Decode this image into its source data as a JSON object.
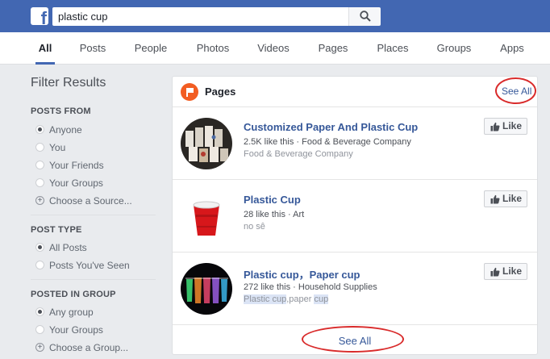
{
  "search": {
    "query": "plastic cup"
  },
  "tabs": [
    {
      "label": "All",
      "active": true
    },
    {
      "label": "Posts"
    },
    {
      "label": "People"
    },
    {
      "label": "Photos"
    },
    {
      "label": "Videos"
    },
    {
      "label": "Pages"
    },
    {
      "label": "Places"
    },
    {
      "label": "Groups"
    },
    {
      "label": "Apps"
    }
  ],
  "filters": {
    "title": "Filter Results",
    "posts_from": {
      "heading": "POSTS FROM",
      "options": [
        "Anyone",
        "You",
        "Your Friends",
        "Your Groups",
        "Choose a Source..."
      ],
      "selected": "Anyone"
    },
    "post_type": {
      "heading": "POST TYPE",
      "options": [
        "All Posts",
        "Posts You've Seen"
      ],
      "selected": "All Posts"
    },
    "posted_in_group": {
      "heading": "POSTED IN GROUP",
      "options": [
        "Any group",
        "Your Groups",
        "Choose a Group..."
      ],
      "selected": "Any group"
    }
  },
  "pages_card": {
    "title": "Pages",
    "see_all_top": "See All",
    "see_all_bottom": "See All",
    "like_label": "Like",
    "results": [
      {
        "name": "Customized Paper And Plastic Cup",
        "likes": "2.5K like this",
        "category": "Food & Beverage Company",
        "subline": "Food & Beverage Company"
      },
      {
        "name": "Plastic Cup",
        "likes": "28 like this",
        "category": "Art",
        "subline": "no sê"
      },
      {
        "name": "Plastic cup，Paper cup",
        "likes": "272 like this",
        "category": "Household Supplies",
        "subline_parts": [
          "Plastic cup",
          ",paper ",
          "cup"
        ]
      }
    ]
  },
  "colors": {
    "brand_blue": "#4267b2",
    "link_blue": "#365899",
    "annotation_red": "#d92b2b",
    "pages_icon_orange": "#f25d22"
  }
}
